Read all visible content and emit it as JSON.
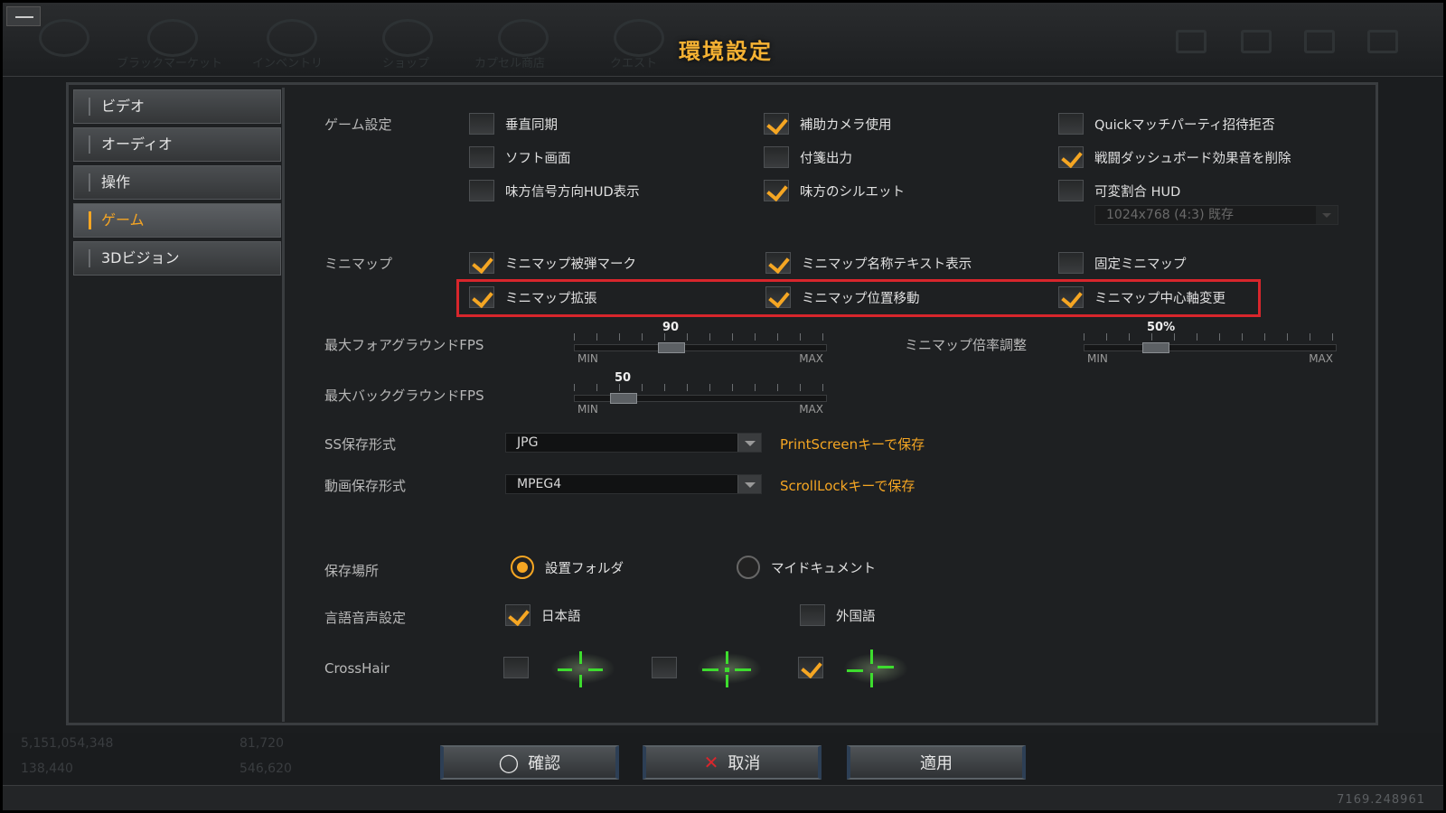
{
  "title": "環境設定",
  "top_nav": [
    {
      "label": "ブラックマーケット",
      "icon": "black-market-icon"
    },
    {
      "label": "インベントリ",
      "icon": "inventory-icon"
    },
    {
      "label": "ショップ",
      "icon": "shop-icon"
    },
    {
      "label": "カプセル商店",
      "icon": "capsule-shop-icon"
    },
    {
      "label": "クエスト",
      "icon": "quest-icon"
    }
  ],
  "sidebar": {
    "items": [
      {
        "label": "ビデオ",
        "active": false
      },
      {
        "label": "オーディオ",
        "active": false
      },
      {
        "label": "操作",
        "active": false
      },
      {
        "label": "ゲーム",
        "active": true
      },
      {
        "label": "3Dビジョン",
        "active": false
      }
    ]
  },
  "game_settings": {
    "label": "ゲーム設定",
    "options": [
      {
        "label": "垂直同期",
        "checked": false
      },
      {
        "label": "補助カメラ使用",
        "checked": true
      },
      {
        "label": "Quickマッチパーティ招待拒否",
        "checked": false
      },
      {
        "label": "ソフト画面",
        "checked": false
      },
      {
        "label": "付箋出力",
        "checked": false
      },
      {
        "label": "戦闘ダッシュボード効果音を削除",
        "checked": true
      },
      {
        "label": "味方信号方向HUD表示",
        "checked": false
      },
      {
        "label": "味方のシルエット",
        "checked": true
      },
      {
        "label": "可変割合 HUD",
        "checked": false
      }
    ],
    "hud_resolution": "1024x768 (4:3) 既存"
  },
  "minimap": {
    "label": "ミニマップ",
    "options": [
      {
        "label": "ミニマップ被弾マーク",
        "checked": true
      },
      {
        "label": "ミニマップ名称テキスト表示",
        "checked": true
      },
      {
        "label": "固定ミニマップ",
        "checked": false
      },
      {
        "label": "ミニマップ拡張",
        "checked": true
      },
      {
        "label": "ミニマップ位置移動",
        "checked": true
      },
      {
        "label": "ミニマップ中心軸変更",
        "checked": true
      }
    ]
  },
  "sliders": {
    "fg_fps": {
      "label": "最大フォアグラウンドFPS",
      "value": "90",
      "fraction": 0.37,
      "min": "MIN",
      "max": "MAX"
    },
    "bg_fps": {
      "label": "最大バックグラウンドFPS",
      "value": "50",
      "fraction": 0.16,
      "min": "MIN",
      "max": "MAX"
    },
    "minimap_scale": {
      "label": "ミニマップ倍率調整",
      "value": "50%",
      "fraction": 0.26,
      "min": "MIN",
      "max": "MAX"
    }
  },
  "screenshot": {
    "label": "SS保存形式",
    "value": "JPG",
    "hint": "PrintScreenキーで保存"
  },
  "video": {
    "label": "動画保存形式",
    "value": "MPEG4",
    "hint": "ScrollLockキーで保存"
  },
  "save_location": {
    "label": "保存場所",
    "options": [
      {
        "label": "設置フォルダ",
        "selected": true
      },
      {
        "label": "マイドキュメント",
        "selected": false
      }
    ]
  },
  "voice_language": {
    "label": "言語音声設定",
    "options": [
      {
        "label": "日本語",
        "checked": true
      },
      {
        "label": "外国語",
        "checked": false
      }
    ]
  },
  "crosshair": {
    "label": "CrossHair",
    "options": [
      {
        "checked": false,
        "icon": "crosshair-cross-icon"
      },
      {
        "checked": false,
        "icon": "crosshair-dot-icon"
      },
      {
        "checked": true,
        "icon": "crosshair-split-icon"
      }
    ]
  },
  "buttons": {
    "confirm": "確認",
    "cancel": "取消",
    "apply": "適用"
  },
  "footer": {
    "stats": [
      "5,151,054,348",
      "81,720",
      "138,440",
      "546,620"
    ],
    "build": "7169.248961"
  },
  "colors": {
    "accent": "#f5a623",
    "highlight": "#d8262c",
    "crosshair": "#3ddc2e"
  }
}
